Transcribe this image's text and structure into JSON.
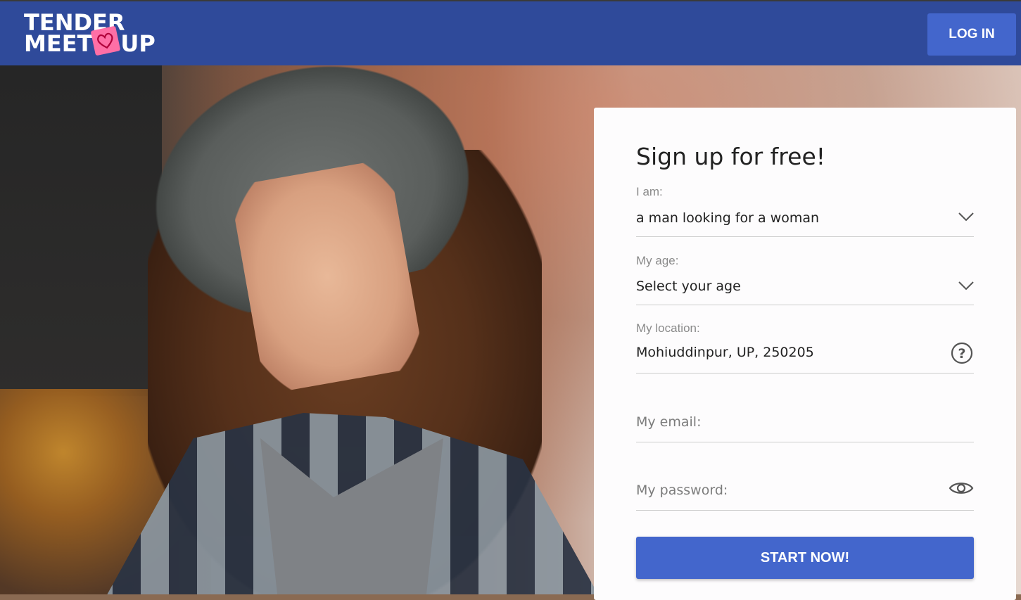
{
  "brand": {
    "line1": "TENDER",
    "line2": "MEET",
    "line3": "UP",
    "header_color": "#2f4a9a"
  },
  "header": {
    "login_label": "LOG IN"
  },
  "signup": {
    "title": "Sign up for free!",
    "iam": {
      "label": "I am:",
      "value": "a man looking for a woman",
      "icon": "chevron-down-icon"
    },
    "age": {
      "label": "My age:",
      "value": "Select your age",
      "icon": "chevron-down-icon"
    },
    "location": {
      "label": "My location:",
      "value": "Mohiuddinpur, UP, 250205",
      "icon": "help-circle-icon"
    },
    "email": {
      "placeholder": "My email:"
    },
    "password": {
      "placeholder": "My password:",
      "icon": "eye-icon"
    },
    "submit_label": "START NOW!",
    "accent_color": "#4366cc"
  }
}
